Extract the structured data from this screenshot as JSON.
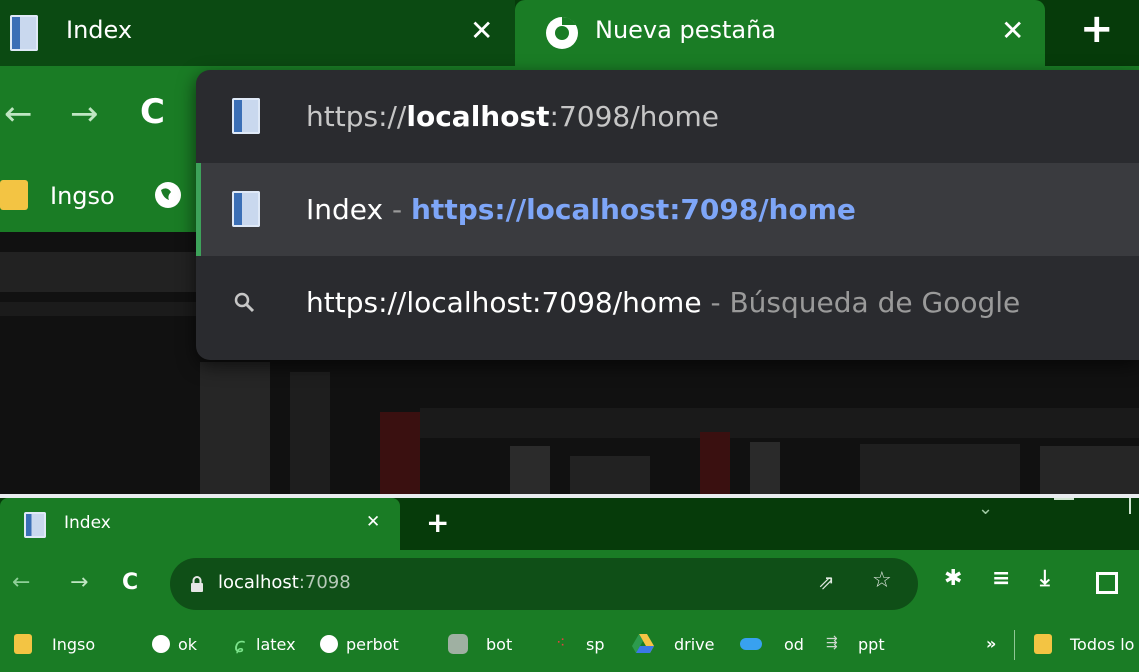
{
  "top": {
    "tabs": [
      {
        "title": "Index"
      },
      {
        "title": "Nueva pestaña"
      }
    ],
    "bookmarks": [
      {
        "label": "Ingso"
      }
    ],
    "suggestions": [
      {
        "prefix": "https://",
        "host": "localhost",
        "rest": ":7098/home"
      },
      {
        "title": "Index",
        "separator": " - ",
        "url": "https://localhost:7098/home"
      },
      {
        "query": "https://localhost:7098/home",
        "separator": " - ",
        "source": "Búsqueda de Google"
      }
    ]
  },
  "bottom": {
    "tab": {
      "title": "Index"
    },
    "address": {
      "host": "localhost",
      "port": ":7098"
    },
    "bookmarks": [
      {
        "label": "Ingso"
      },
      {
        "label": "ok"
      },
      {
        "label": "latex"
      },
      {
        "label": "perbot"
      },
      {
        "label": "bot"
      },
      {
        "label": "sp"
      },
      {
        "label": "drive"
      },
      {
        "label": "od"
      },
      {
        "label": "ppt"
      }
    ],
    "more": "»",
    "all_bookmarks": "Todos lo"
  },
  "colors": {
    "accent_green": "#1a7c25",
    "dark_green": "#063b0a",
    "link_blue": "#7ea6f8"
  }
}
